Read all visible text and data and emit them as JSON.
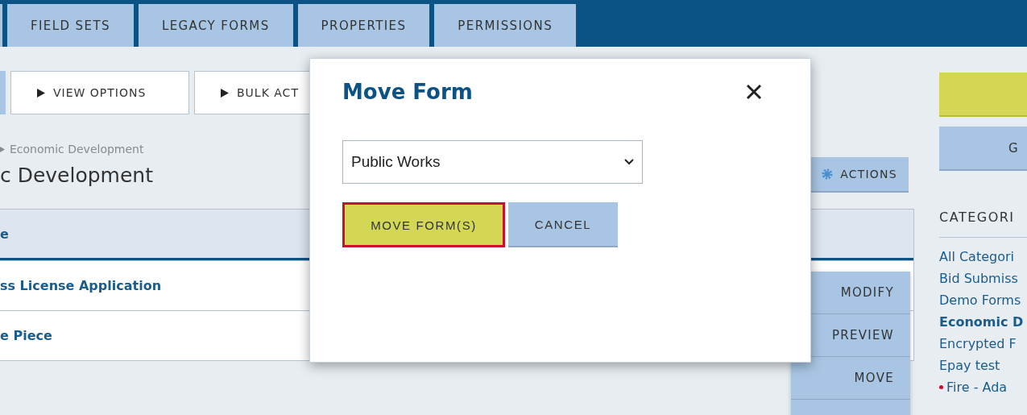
{
  "tabs": [
    {
      "label": "FIELD SETS",
      "selected": false
    },
    {
      "label": "LEGACY FORMS",
      "selected": false
    },
    {
      "label": "PROPERTIES",
      "selected": false
    },
    {
      "label": "PERMISSIONS",
      "selected": false
    }
  ],
  "toolbar": {
    "buttons": [
      "VIEW OPTIONS",
      "BULK ACT"
    ]
  },
  "breadcrumb": "Economic Development",
  "heading": "c Development",
  "actions_button": "ACTIONS",
  "table": {
    "columns": [
      "e"
    ],
    "rows": [
      {
        "name": "ss License Application"
      },
      {
        "name": "e Piece"
      }
    ]
  },
  "row_menu": {
    "items": [
      "MODIFY",
      "PREVIEW",
      "MOVE"
    ]
  },
  "sidebar": {
    "go_button": "G",
    "categories_title": "CATEGORI",
    "items": [
      {
        "label": "All Categori",
        "selected": false,
        "flagged": false
      },
      {
        "label": "Bid Submiss",
        "selected": false,
        "flagged": false
      },
      {
        "label": "Demo Forms",
        "selected": false,
        "flagged": false
      },
      {
        "label": "Economic D",
        "selected": true,
        "flagged": false
      },
      {
        "label": "Encrypted F",
        "selected": false,
        "flagged": false
      },
      {
        "label": "Epay test",
        "selected": false,
        "flagged": false
      },
      {
        "label": "Fire - Ada",
        "selected": false,
        "flagged": true
      }
    ]
  },
  "dialog": {
    "title": "Move Form",
    "select_value": "Public Works",
    "primary_button": "MOVE FORM(S)",
    "primary_focused": true,
    "cancel_button": "CANCEL"
  }
}
